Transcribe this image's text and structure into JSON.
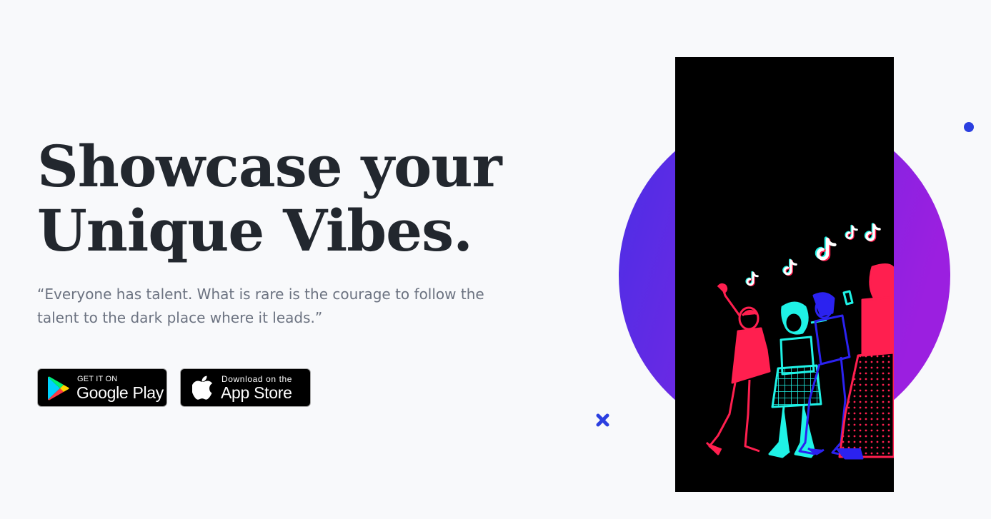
{
  "hero": {
    "title_line1": "Showcase your",
    "title_line2": "Unique Vibes.",
    "quote": "“Everyone has talent. What is rare is the courage to follow the talent to the dark place where it leads.”"
  },
  "badges": {
    "google_play": {
      "small_text": "GET IT ON",
      "big_text": "Google Play",
      "icon": "google-play-icon"
    },
    "app_store": {
      "small_text": "Download on the",
      "big_text": "App Store",
      "icon": "apple-icon"
    }
  },
  "colors": {
    "background": "#f8f9fb",
    "title": "#22272e",
    "quote": "#6b7280",
    "circle_gradient_start": "#4a2fe6",
    "circle_gradient_end": "#9b1fe0",
    "accent_blue": "#2b3fe0",
    "illustration_red": "#ff1f4f",
    "illustration_cyan": "#1ff2e6",
    "illustration_blue": "#2b22f0"
  },
  "decorations": {
    "dot": "blue-dot",
    "cross": "blue-cross-icon",
    "notes": "tiktok-note-icon"
  }
}
